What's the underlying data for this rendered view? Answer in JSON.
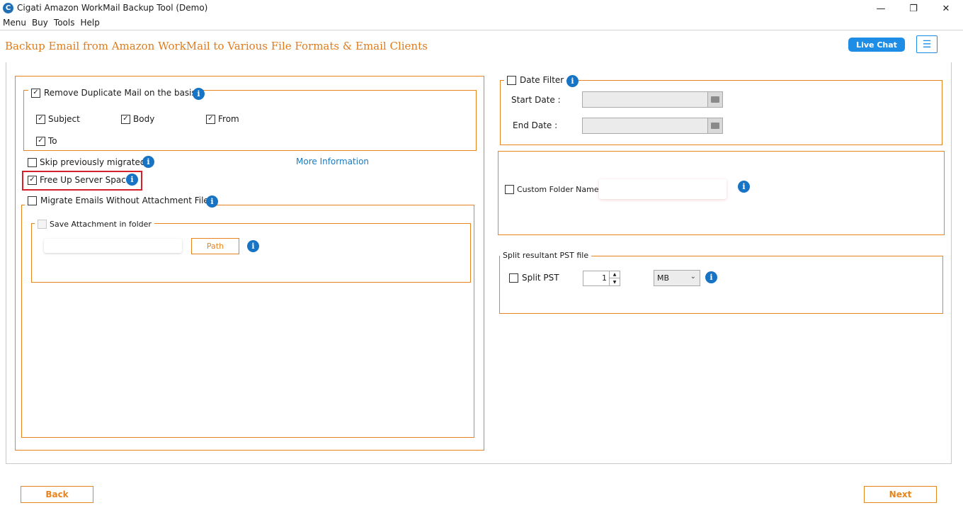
{
  "window": {
    "title": "Cigati Amazon WorkMail Backup Tool (Demo)",
    "controls": {
      "minimize": "—",
      "maximize": "❐",
      "close": "✕"
    }
  },
  "menu": [
    "Menu",
    "Buy",
    "Tools",
    "Help"
  ],
  "header": {
    "title": "Backup Email from Amazon WorkMail to Various File Formats & Email Clients",
    "live_chat": "Live Chat",
    "menu_icon": "☰"
  },
  "left": {
    "duplicate": {
      "label": "Remove Duplicate Mail on the basis",
      "checked": true,
      "options": [
        {
          "label": "Subject",
          "checked": true
        },
        {
          "label": "Body",
          "checked": true
        },
        {
          "label": "From",
          "checked": true
        },
        {
          "label": "To",
          "checked": true
        }
      ]
    },
    "skip_migrated": {
      "label": "Skip previously migrated",
      "checked": false
    },
    "more_info": "More Information",
    "free_space": {
      "label": "Free Up Server Space",
      "checked": true
    },
    "no_attachment": {
      "label": "Migrate Emails Without Attachment Files",
      "checked": false
    },
    "save_attachment": {
      "label": "Save Attachment in folder",
      "checked": false,
      "path_value": "",
      "path_button": "Path"
    }
  },
  "right": {
    "date_filter": {
      "label": "Date Filter",
      "checked": false,
      "start_label": "Start Date :",
      "end_label": "End Date :",
      "start_value": "",
      "end_value": ""
    },
    "custom_folder": {
      "label": "Custom Folder Name",
      "checked": false,
      "value": ""
    },
    "split": {
      "group_label": "Split resultant PST file",
      "label": "Split PST",
      "checked": false,
      "size_value": "1",
      "unit": "MB"
    }
  },
  "footer": {
    "back": "Back",
    "next": "Next"
  },
  "check_mark": "✓"
}
